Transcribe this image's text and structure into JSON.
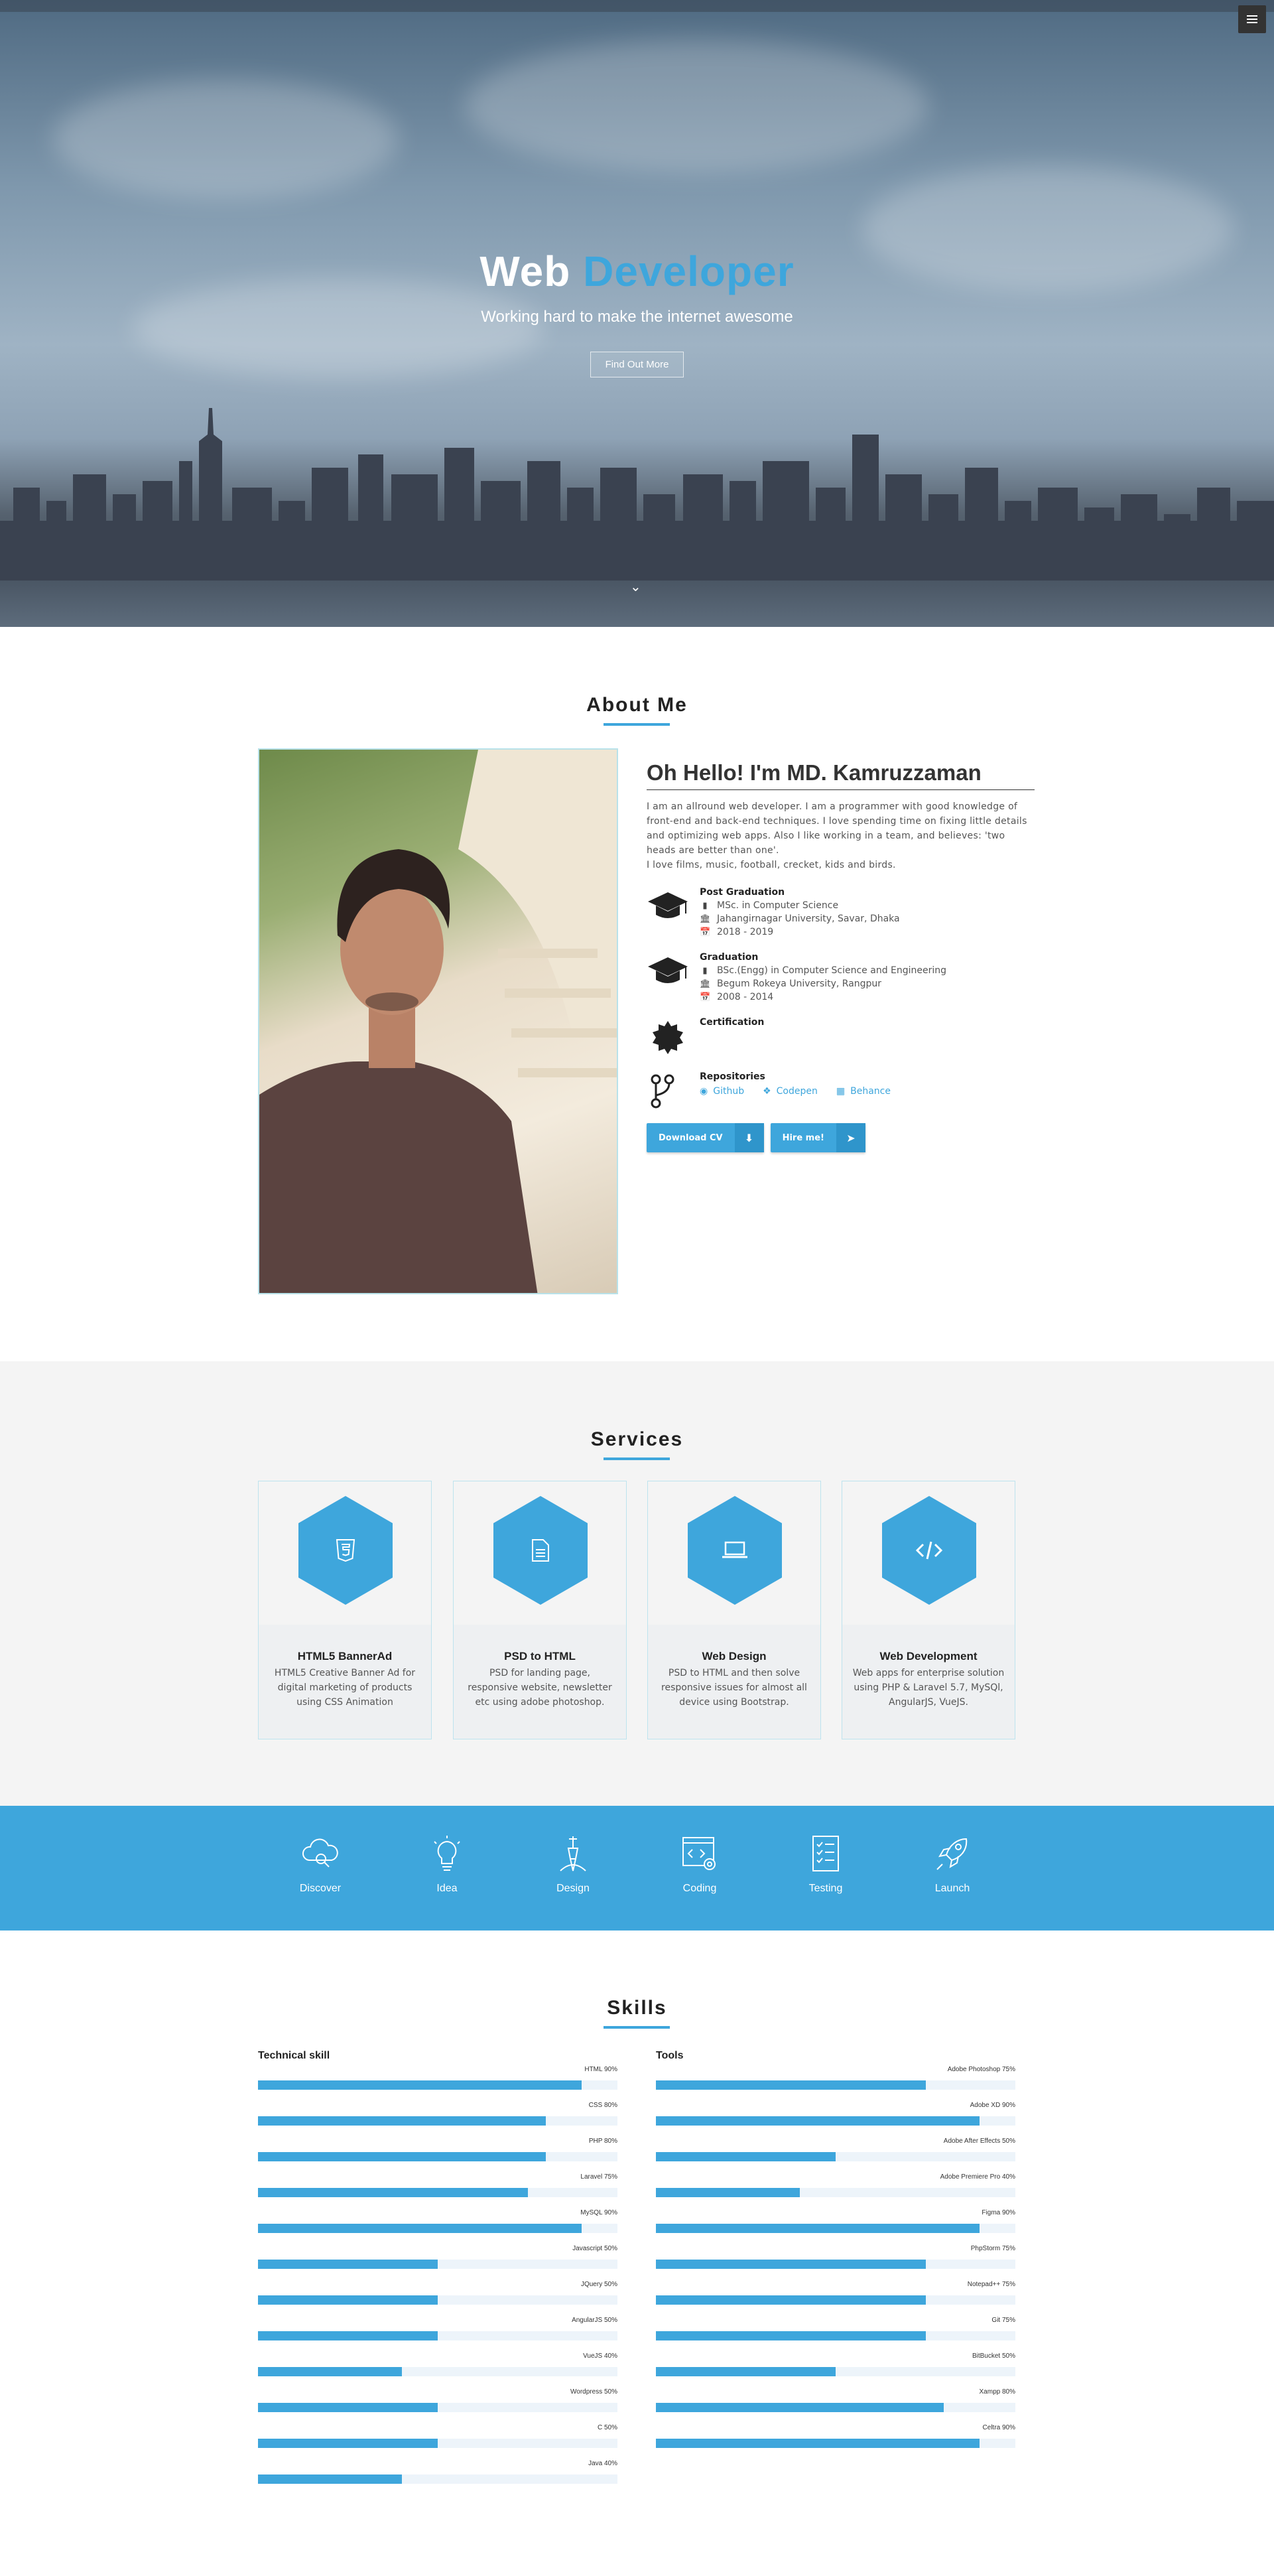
{
  "hero": {
    "title_part1": "Web",
    "title_part2": "Developer",
    "subtitle": "Working hard to make the internet awesome",
    "cta": "Find Out More"
  },
  "about": {
    "title": "About Me",
    "hello": "Oh Hello! I'm MD. Kamruzzaman",
    "bio": "I am an allround web developer. I am a programmer with good knowledge of front-end and back-end techniques. I love spending time on fixing little details and optimizing web apps. Also I like working in a team, and believes: 'two heads are better than one'.",
    "bio2": "I love films, music, football, crecket, kids and birds.",
    "post_grad": {
      "title": "Post Graduation",
      "degree": "MSc. in Computer Science",
      "institute": "Jahangirnagar University, Savar, Dhaka",
      "years": "2018 - 2019"
    },
    "grad": {
      "title": "Graduation",
      "degree": "BSc.(Engg) in Computer Science and Engineering",
      "institute": "Begum Rokeya University, Rangpur",
      "years": "2008 - 2014"
    },
    "certification": "Certification",
    "repositories": {
      "title": "Repositories",
      "links": [
        "Github",
        "Codepen",
        "Behance"
      ]
    },
    "download_cv": "Download CV",
    "hire_me": "Hire me!"
  },
  "services": {
    "title": "Services",
    "items": [
      {
        "icon": "html5-icon",
        "title": "HTML5 BannerAd",
        "desc": "HTML5 Creative Banner Ad for digital marketing of products using CSS Animation"
      },
      {
        "icon": "document-icon",
        "title": "PSD to HTML",
        "desc": "PSD for landing page, responsive website, newsletter etc using adobe photoshop."
      },
      {
        "icon": "laptop-icon",
        "title": "Web Design",
        "desc": "PSD to HTML and then solve responsive issues for almost all device using Bootstrap."
      },
      {
        "icon": "code-icon",
        "title": "Web Development",
        "desc": "Web apps for enterprise solution using PHP & Laravel 5.7, MySQl, AngularJS, VueJS."
      }
    ]
  },
  "process": [
    "Discover",
    "Idea",
    "Design",
    "Coding",
    "Testing",
    "Launch"
  ],
  "skills": {
    "title": "Skills",
    "technical_title": "Technical skill",
    "tools_title": "Tools",
    "technical": [
      {
        "label": "HTML 90%",
        "value": 90
      },
      {
        "label": "CSS 80%",
        "value": 80
      },
      {
        "label": "PHP 80%",
        "value": 80
      },
      {
        "label": "Laravel 75%",
        "value": 75
      },
      {
        "label": "MySQL 90%",
        "value": 90
      },
      {
        "label": "Javascript 50%",
        "value": 50
      },
      {
        "label": "JQuery 50%",
        "value": 50
      },
      {
        "label": "AngularJS 50%",
        "value": 50
      },
      {
        "label": "VueJS 40%",
        "value": 40
      },
      {
        "label": "Wordpress 50%",
        "value": 50
      },
      {
        "label": "C 50%",
        "value": 50
      },
      {
        "label": "Java 40%",
        "value": 40
      }
    ],
    "tools": [
      {
        "label": "Adobe Photoshop 75%",
        "value": 75
      },
      {
        "label": "Adobe XD 90%",
        "value": 90
      },
      {
        "label": "Adobe After Effects 50%",
        "value": 50
      },
      {
        "label": "Adobe Premiere Pro 40%",
        "value": 40
      },
      {
        "label": "Figma 90%",
        "value": 90
      },
      {
        "label": "PhpStorm 75%",
        "value": 75
      },
      {
        "label": "Notepad++ 75%",
        "value": 75
      },
      {
        "label": "Git 75%",
        "value": 75
      },
      {
        "label": "BitBucket 50%",
        "value": 50
      },
      {
        "label": "Xampp 80%",
        "value": 80
      },
      {
        "label": "Celtra 90%",
        "value": 90
      }
    ]
  },
  "colors": {
    "accent": "#3ea6dc",
    "services_bg": "#f4f4f4"
  }
}
